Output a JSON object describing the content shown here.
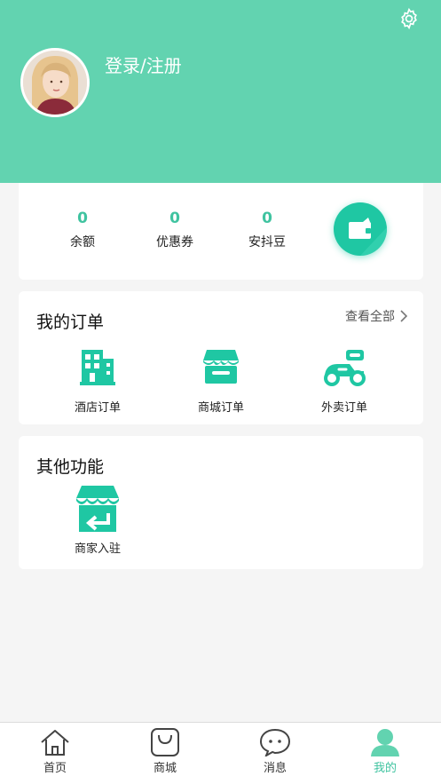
{
  "header": {
    "login_label": "登录/注册",
    "settings_icon": "gear-icon",
    "background_color": "#62d3b0"
  },
  "assets": {
    "items": [
      {
        "value": "0",
        "label": "余额"
      },
      {
        "value": "0",
        "label": "优惠券"
      },
      {
        "value": "0",
        "label": "安抖豆"
      }
    ],
    "wallet_icon": "wallet-icon"
  },
  "orders": {
    "title": "我的订单",
    "see_all": "查看全部",
    "items": [
      {
        "label": "酒店订单",
        "icon": "hotel-building-icon"
      },
      {
        "label": "商城订单",
        "icon": "shop-store-icon"
      },
      {
        "label": "外卖订单",
        "icon": "delivery-scooter-icon"
      }
    ]
  },
  "other": {
    "title": "其他功能",
    "items": [
      {
        "label": "商家入驻",
        "icon": "merchant-store-icon"
      }
    ]
  },
  "tabbar": {
    "active_color": "#3fc3a0",
    "items": [
      {
        "label": "首页",
        "icon": "home-icon"
      },
      {
        "label": "商城",
        "icon": "shopping-bag-icon"
      },
      {
        "label": "消息",
        "icon": "chat-bubble-icon"
      },
      {
        "label": "我的",
        "icon": "user-icon"
      }
    ]
  }
}
